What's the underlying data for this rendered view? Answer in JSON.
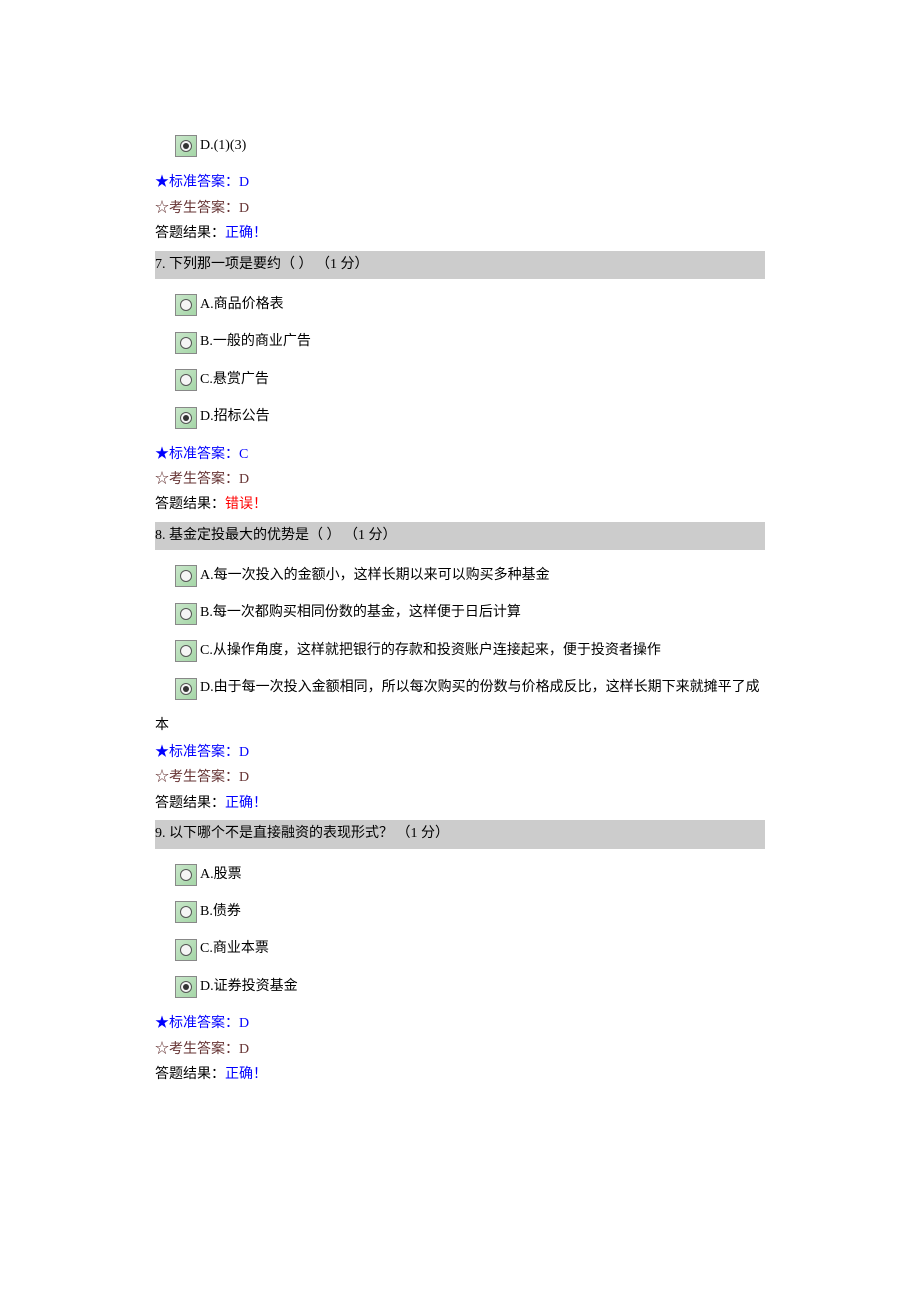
{
  "q6_partial": {
    "options": [
      {
        "key": "D",
        "label": "D.(1)(3)",
        "selected": true
      }
    ],
    "standard_answer": "★标准答案：D",
    "student_answer": "☆考生答案：D",
    "result_label": "答题结果：",
    "result_value": "正确！",
    "result_status": "correct"
  },
  "q7": {
    "header": "7. 下列那一项是要约（ ） （1 分）",
    "options": [
      {
        "key": "A",
        "label": "A.商品价格表",
        "selected": false
      },
      {
        "key": "B",
        "label": "B.一般的商业广告",
        "selected": false
      },
      {
        "key": "C",
        "label": "C.悬赏广告",
        "selected": false
      },
      {
        "key": "D",
        "label": "D.招标公告",
        "selected": true
      }
    ],
    "standard_answer": "★标准答案：C",
    "student_answer": "☆考生答案：D",
    "result_label": "答题结果：",
    "result_value": "错误！",
    "result_status": "wrong"
  },
  "q8": {
    "header": "8. 基金定投最大的优势是（ ） （1 分）",
    "options": [
      {
        "key": "A",
        "label": "A.每一次投入的金额小，这样长期以来可以购买多种基金",
        "selected": false
      },
      {
        "key": "B",
        "label": "B.每一次都购买相同份数的基金，这样便于日后计算",
        "selected": false
      },
      {
        "key": "C",
        "label": "C.从操作角度，这样就把银行的存款和投资账户连接起来，便于投资者操作",
        "selected": false
      },
      {
        "key": "D",
        "label": "D.由于每一次投入金额相同，所以每次购买的份数与价格成反比，这样长期下来就摊平了成",
        "selected": true
      }
    ],
    "continuation": "本",
    "standard_answer": "★标准答案：D",
    "student_answer": "☆考生答案：D",
    "result_label": "答题结果：",
    "result_value": "正确！",
    "result_status": "correct"
  },
  "q9": {
    "header": "9. 以下哪个不是直接融资的表现形式？ （1 分）",
    "options": [
      {
        "key": "A",
        "label": "A.股票",
        "selected": false
      },
      {
        "key": "B",
        "label": "B.债券",
        "selected": false
      },
      {
        "key": "C",
        "label": "C.商业本票",
        "selected": false
      },
      {
        "key": "D",
        "label": "D.证券投资基金",
        "selected": true
      }
    ],
    "standard_answer": "★标准答案：D",
    "student_answer": "☆考生答案：D",
    "result_label": "答题结果：",
    "result_value": "正确！",
    "result_status": "correct"
  }
}
